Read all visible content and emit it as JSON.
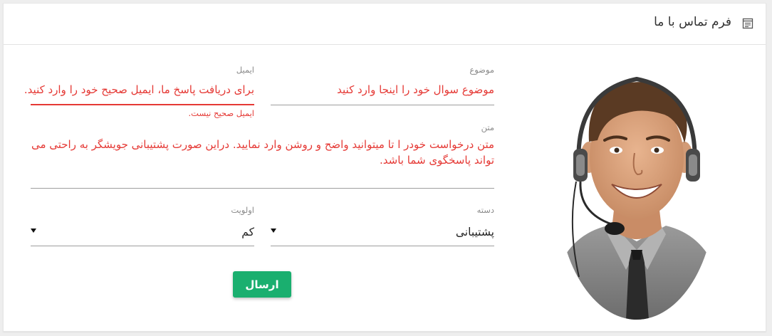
{
  "header": {
    "title": "فرم تماس با ما",
    "icon": "form-icon"
  },
  "form": {
    "subject": {
      "label": "موضوع",
      "value": "موضوع سوال خود را اینجا وارد کنید"
    },
    "email": {
      "label": "ایمیل",
      "value": "برای دریافت پاسخ ما، ایمیل صحیح خود را  وارد کنید.",
      "error": "ایمیل صحیح نیست."
    },
    "message": {
      "label": "متن",
      "value": "متن درخواست خودر ا تا میتوانید واضح و روشن وارد نمایید. دراین صورت پشتیبانی جویشگر به راحتی می تواند پاسخگوی شما باشد."
    },
    "category": {
      "label": "دسته",
      "selected": "پشتیبانی"
    },
    "priority": {
      "label": "اولویت",
      "selected": "کم"
    },
    "submit_label": "ارسال"
  },
  "colors": {
    "error": "#e53935",
    "accent": "#1aaf6f",
    "muted_label": "#8a8a8a"
  },
  "image": {
    "subject": "support-agent-with-headset-photo"
  }
}
